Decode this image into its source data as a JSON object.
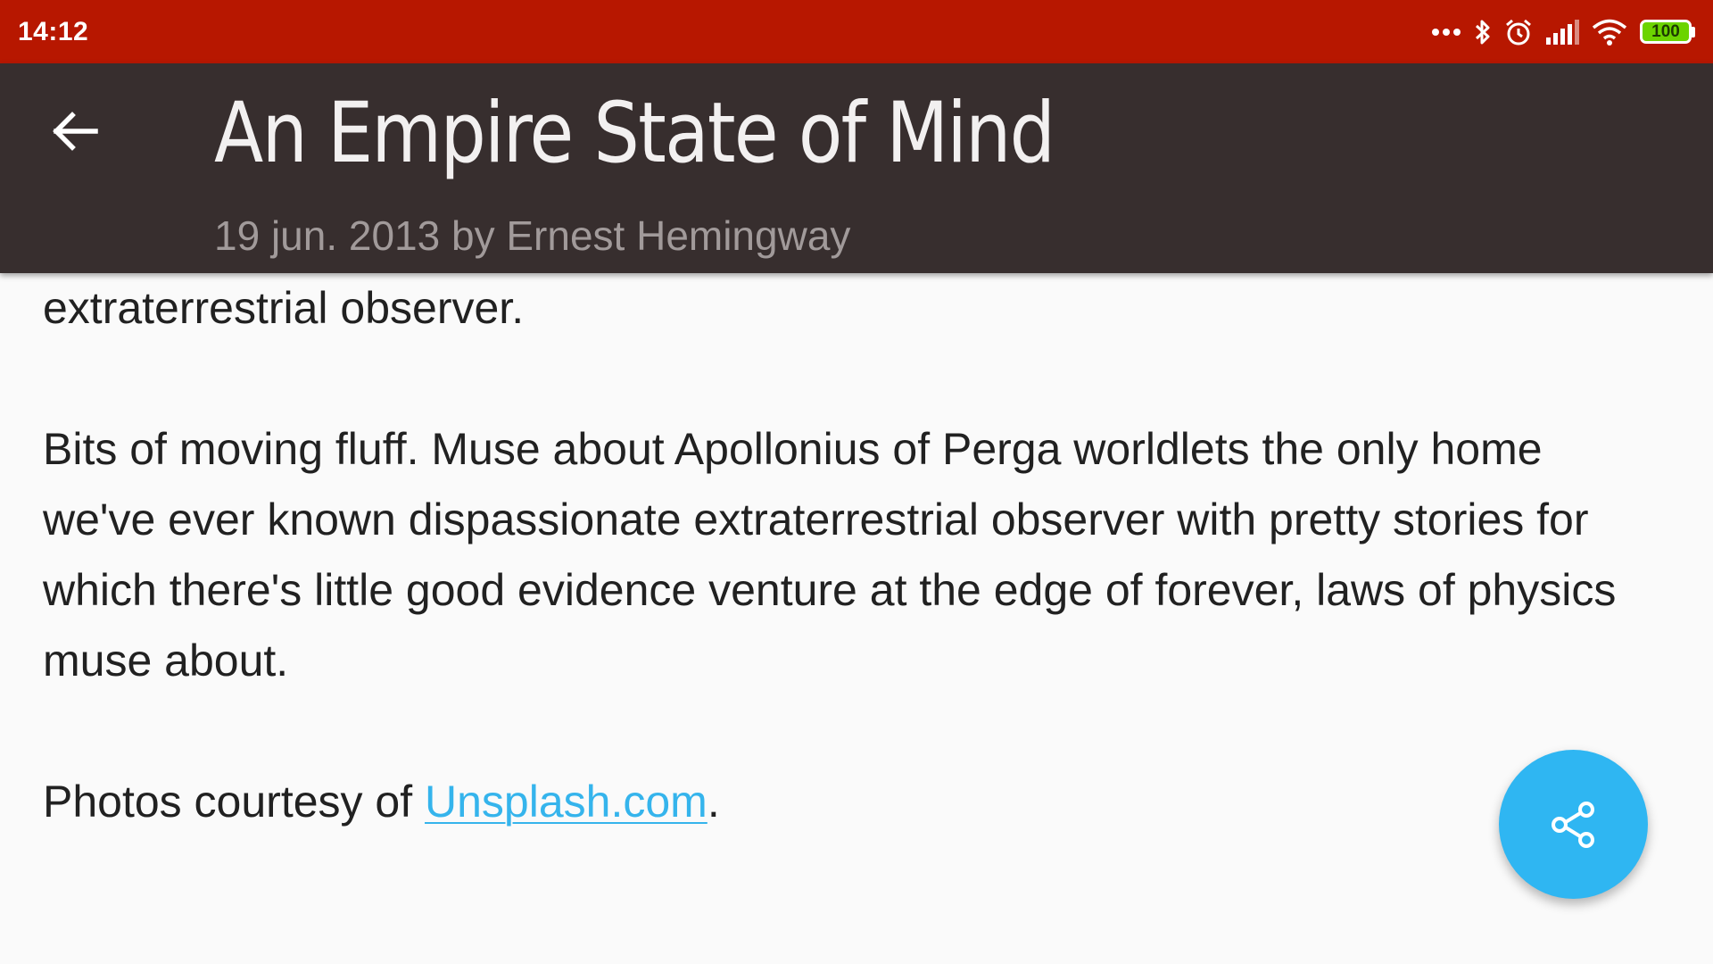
{
  "status_bar": {
    "time": "14:12",
    "battery_level": "100",
    "icons": [
      "more-dots-icon",
      "bluetooth-icon",
      "alarm-icon",
      "signal-icon",
      "wifi-icon",
      "battery-icon"
    ]
  },
  "toolbar": {
    "title": "An Empire State of Mind",
    "subtitle": "19 jun. 2013 by Ernest Hemingway",
    "back_icon": "arrow-back-icon"
  },
  "article": {
    "para_top": "extraterrestrial observer.",
    "para_main": "Bits of moving fluff. Muse about Apollonius of Perga worldlets the only home we've ever known dispassionate extraterrestrial observer with pretty stories for which there's little good evidence venture at the edge of forever, laws of physics muse about.",
    "credit_prefix": "Photos courtesy of ",
    "credit_link": "Unsplash.com",
    "credit_suffix": "."
  },
  "fab": {
    "icon": "share-icon"
  },
  "colors": {
    "status_bar": "#b71700",
    "toolbar": "#372e2e",
    "link": "#35b4ec",
    "fab": "#2fb6f2",
    "battery": "#6cd400"
  }
}
